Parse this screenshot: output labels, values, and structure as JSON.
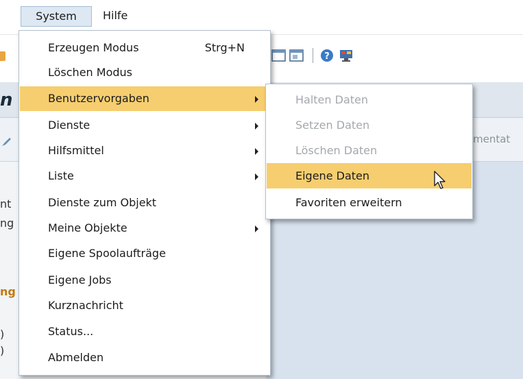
{
  "menubar": {
    "system_label": "System",
    "help_label": "Hilfe"
  },
  "system_menu": {
    "items": [
      {
        "label": "Erzeugen Modus",
        "shortcut": "Strg+N",
        "has_submenu": false,
        "highlighted": false
      },
      {
        "label": "Löschen Modus",
        "shortcut": "",
        "has_submenu": false,
        "highlighted": false
      },
      {
        "label": "Benutzervorgaben",
        "shortcut": "",
        "has_submenu": true,
        "highlighted": true
      },
      {
        "label": "Dienste",
        "shortcut": "",
        "has_submenu": true,
        "highlighted": false
      },
      {
        "label": "Hilfsmittel",
        "shortcut": "",
        "has_submenu": true,
        "highlighted": false
      },
      {
        "label": "Liste",
        "shortcut": "",
        "has_submenu": true,
        "highlighted": false
      },
      {
        "label": "Dienste zum Objekt",
        "shortcut": "",
        "has_submenu": false,
        "highlighted": false
      },
      {
        "label": "Meine Objekte",
        "shortcut": "",
        "has_submenu": true,
        "highlighted": false
      },
      {
        "label": "Eigene Spoolaufträge",
        "shortcut": "",
        "has_submenu": false,
        "highlighted": false
      },
      {
        "label": "Eigene Jobs",
        "shortcut": "",
        "has_submenu": false,
        "highlighted": false
      },
      {
        "label": "Kurznachricht",
        "shortcut": "",
        "has_submenu": false,
        "highlighted": false
      },
      {
        "label": "Status...",
        "shortcut": "",
        "has_submenu": false,
        "highlighted": false
      },
      {
        "label": "Abmelden",
        "shortcut": "",
        "has_submenu": false,
        "highlighted": false
      }
    ]
  },
  "submenu": {
    "items": [
      {
        "label": "Halten Daten",
        "disabled": true,
        "highlighted": false
      },
      {
        "label": "Setzen Daten",
        "disabled": true,
        "highlighted": false
      },
      {
        "label": "Löschen Daten",
        "disabled": true,
        "highlighted": false
      },
      {
        "label": "Eigene Daten",
        "disabled": false,
        "highlighted": true
      },
      {
        "label": "Favoriten erweitern",
        "disabled": false,
        "highlighted": false
      }
    ]
  },
  "background": {
    "title_fragment": "n",
    "column_fragment": "mentat",
    "side_fragments": [
      "nt",
      "ng",
      "ng",
      ")",
      ")"
    ]
  },
  "colors": {
    "menu_highlight": "#f6ce6f",
    "active_menubar": "#dde8f3",
    "disabled_text": "#a4a9ae"
  },
  "icons": {
    "toolbar": [
      "window-icon",
      "window-icon",
      "help-icon",
      "monitor-icon"
    ],
    "cursor": "mouse-pointer-icon",
    "submenu_arrow": "chevron-right-icon"
  }
}
